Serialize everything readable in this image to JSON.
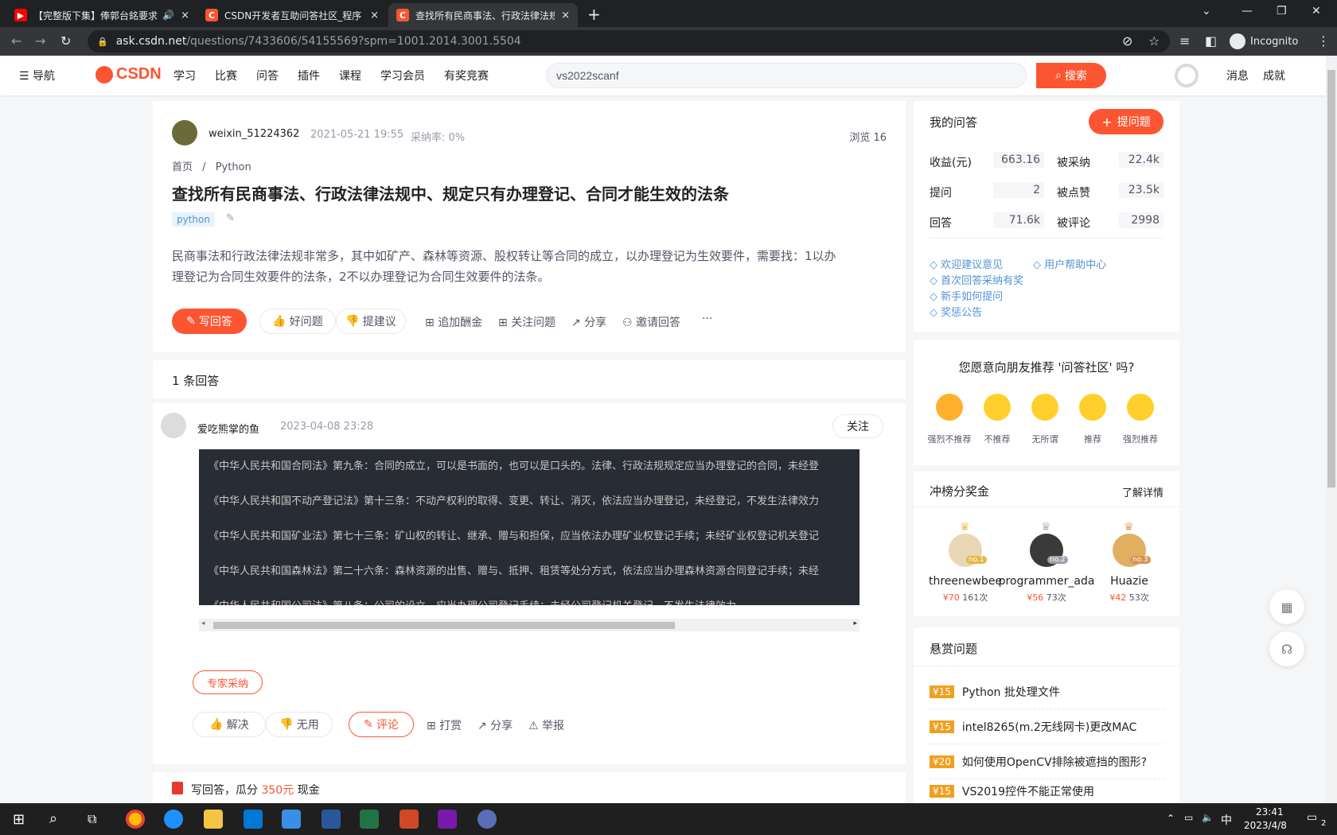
{
  "browser": {
    "tabs": [
      {
        "title": "【完整版下集】俸郭台銘要求",
        "close": "×"
      },
      {
        "title": "CSDN开发者互助问答社区_程序",
        "close": "×"
      },
      {
        "title": "查找所有民商事法、行政法律法规",
        "close": "×"
      }
    ],
    "new_tab": "+",
    "url_host": "ask.csdn.net",
    "url_path": "/questions/7433606/54155569?spm=1001.2014.3001.5504",
    "profile": "Incognito"
  },
  "site_header": {
    "nav_toggle": "导航",
    "logo_text": "CSDN",
    "nav": [
      "学习",
      "比赛",
      "问答",
      "插件",
      "课程",
      "学习会员",
      "有奖竞赛"
    ],
    "search_value": "vs2022scanf",
    "search_button": "搜索",
    "right_links": [
      "消息",
      "成就"
    ]
  },
  "question": {
    "author": "weixin_51224362",
    "date": "2021-05-21 19:55",
    "accept_rate": "采纳率: 0%",
    "views": "浏览 16",
    "breadcrumb_home": "首页",
    "breadcrumb_sep": "/",
    "breadcrumb_cat": "Python",
    "title": "查找所有民商事法、行政法律法规中、规定只有办理登记、合同才能生效的法条",
    "tag": "python",
    "body_line1": "民商事法和行政法律法规非常多，其中如矿产、森林等资源、股权转让等合同的成立，以办理登记为生效要件，需要找：1以办",
    "body_line2": "理登记为合同生效要件的法条，2不以办理登记为合同生效要件的法条。",
    "actions": {
      "answer": "写回答",
      "good": "好问题",
      "suggest": "提建议",
      "bounty": "追加酬金",
      "follow": "关注问题",
      "share": "分享",
      "invite": "邀请回答",
      "more": "···"
    }
  },
  "answers": {
    "count_label": "1 条回答",
    "items": [
      {
        "author": "爱吃熊掌的鱼",
        "date": "2023-04-08 23:28",
        "follow": "关注",
        "code_lines": [
          "《中华人民共和国合同法》第九条：合同的成立，可以是书面的，也可以是口头的。法律、行政法规规定应当办理登记的合同，未经登",
          "《中华人民共和国不动产登记法》第十三条：不动产权利的取得、变更、转让、消灭，依法应当办理登记，未经登记，不发生法律效力",
          "《中华人民共和国矿业法》第七十三条：矿山权的转让、继承、赠与和担保，应当依法办理矿业权登记手续；未经矿业权登记机关登记",
          "《中华人民共和国森林法》第二十六条：森林资源的出售、赠与、抵押、租赁等处分方式，依法应当办理森林资源合同登记手续；未经",
          "《中华人民共和国公司法》第八条：公司的设立，应当办理公司登记手续；未经公司登记机关登记，不发生法律效力。"
        ],
        "expert_tag": "专家采纳",
        "solve": "解决",
        "useless": "无用",
        "comment": "评论",
        "reward": "打赏",
        "share": "分享",
        "report": "举报"
      }
    ],
    "promo_prefix": "写回答，瓜分",
    "promo_amount": "350元",
    "promo_suffix": "现金"
  },
  "sidebar": {
    "my_qa_title": "我的问答",
    "ask_button": "提问题",
    "stats": [
      {
        "label": "收益(元)",
        "value": "663.16",
        "label2": "被采纳",
        "value2": "22.4k"
      },
      {
        "label": "提问",
        "value": "2",
        "label2": "被点赞",
        "value2": "23.5k"
      },
      {
        "label": "回答",
        "value": "71.6k",
        "label2": "被评论",
        "value2": "2998"
      }
    ],
    "links": [
      "欢迎建议意见",
      "用户帮助中心",
      "首次回答采纳有奖",
      "新手如何提问",
      "奖惩公告"
    ],
    "recommend_q": "您愿意向朋友推荐 '问答社区' 吗?",
    "recommend_opts": [
      "强烈不推荐",
      "不推荐",
      "无所谓",
      "推荐",
      "强烈推荐"
    ],
    "rank_title": "冲榜分奖金",
    "rank_more": "了解详情",
    "rank": [
      {
        "name": "threenewbee",
        "badge": "no.1",
        "money": "¥70",
        "times": "161次",
        "color": "#e9d7b5"
      },
      {
        "name": "programmer_ada",
        "badge": "no.2",
        "money": "¥56",
        "times": "73次",
        "color": "#3a3a3a"
      },
      {
        "name": "Huazie",
        "badge": "no.3",
        "money": "¥42",
        "times": "53次",
        "color": "#e0b060"
      }
    ],
    "bounty_title": "悬赏问题",
    "bounties": [
      {
        "amount": "¥15",
        "title": "Python 批处理文件"
      },
      {
        "amount": "¥15",
        "title": "intel8265(m.2无线网卡)更改MAC"
      },
      {
        "amount": "¥20",
        "title": "如何使用OpenCV排除被遮挡的图形?"
      },
      {
        "amount": "¥15",
        "title": "VS2019控件不能正常使用"
      }
    ]
  },
  "taskbar": {
    "ime": "中",
    "time": "23:41",
    "date": "2023/4/8",
    "notify": "2"
  },
  "colors": {
    "brand": "#fc5531",
    "link": "#5094d5"
  }
}
